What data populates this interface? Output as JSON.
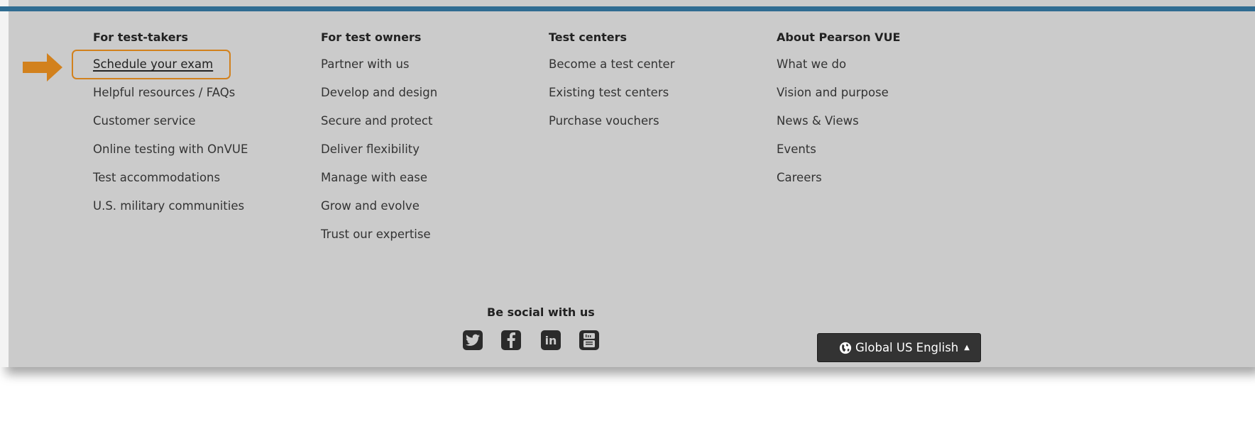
{
  "columns": [
    {
      "heading": "For test-takers",
      "links": [
        "Schedule your exam",
        "Helpful resources / FAQs",
        "Customer service",
        "Online testing with OnVUE",
        "Test accommodations",
        "U.S. military communities"
      ]
    },
    {
      "heading": "For test owners",
      "links": [
        "Partner with us",
        "Develop and design",
        "Secure and protect",
        "Deliver flexibility",
        "Manage with ease",
        "Grow and evolve",
        "Trust our expertise"
      ]
    },
    {
      "heading": "Test centers",
      "links": [
        "Become a test center",
        "Existing test centers",
        "Purchase vouchers"
      ]
    },
    {
      "heading": "About Pearson VUE",
      "links": [
        "What we do",
        "Vision and purpose",
        "News & Views",
        "Events",
        "Careers"
      ]
    }
  ],
  "social": {
    "title": "Be social with us",
    "icons": [
      "twitter-icon",
      "facebook-icon",
      "linkedin-icon",
      "youtube-icon"
    ]
  },
  "language_selector": {
    "label": "Global US English"
  },
  "colors": {
    "panel_bg": "#cbcbcb",
    "top_bar": "#2f6c92",
    "highlight": "#d2811d",
    "button_bg": "#333333"
  }
}
